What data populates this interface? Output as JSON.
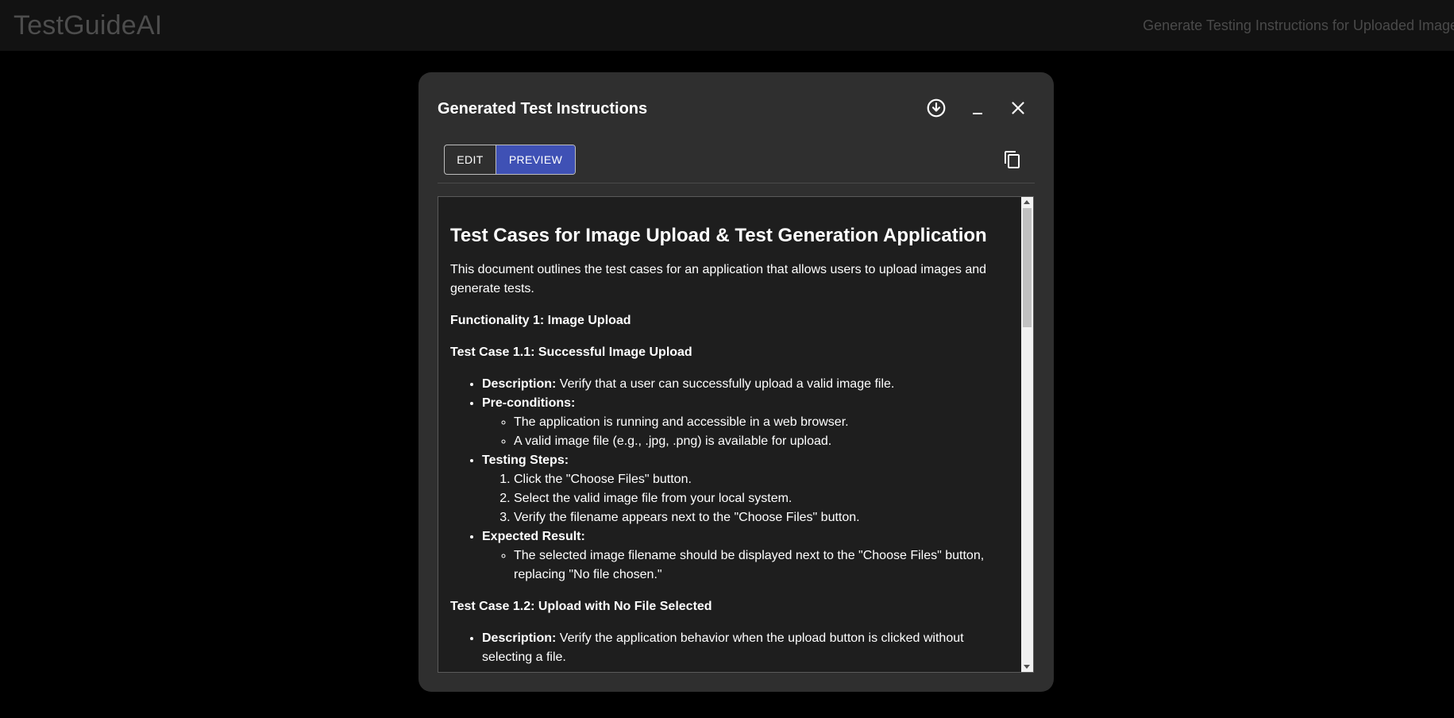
{
  "app": {
    "title": "TestGuideAI",
    "subtitle": "Generate Testing Instructions for Uploaded Images"
  },
  "dialog": {
    "title": "Generated Test Instructions",
    "icons": {
      "download": "download-circle-icon",
      "minimize": "minimize-icon",
      "close": "close-icon",
      "copy": "copy-icon"
    },
    "tabs": {
      "edit": "EDIT",
      "preview": "PREVIEW",
      "selected": "PREVIEW"
    },
    "accent_color": "#3f51b5"
  },
  "doc": {
    "heading": "Test Cases for Image Upload & Test Generation Application",
    "intro": "This document outlines the test cases for an application that allows users to upload images and generate tests.",
    "functionality1": "Functionality 1: Image Upload",
    "tc11": {
      "title": "Test Case 1.1: Successful Image Upload",
      "description_label": "Description:",
      "description": " Verify that a user can successfully upload a valid image file.",
      "preconditions_label": "Pre-conditions:",
      "preconditions": [
        "The application is running and accessible in a web browser.",
        "A valid image file (e.g., .jpg, .png) is available for upload."
      ],
      "steps_label": "Testing Steps:",
      "steps": [
        "Click the \"Choose Files\" button.",
        "Select the valid image file from your local system.",
        "Verify the filename appears next to the \"Choose Files\" button."
      ],
      "expected_label": "Expected Result:",
      "expected": [
        "The selected image filename should be displayed next to the \"Choose Files\" button, replacing \"No file chosen.\""
      ]
    },
    "tc12": {
      "title": "Test Case 1.2: Upload with No File Selected",
      "description_label": "Description:",
      "description": " Verify the application behavior when the upload button is clicked without selecting a file."
    }
  }
}
